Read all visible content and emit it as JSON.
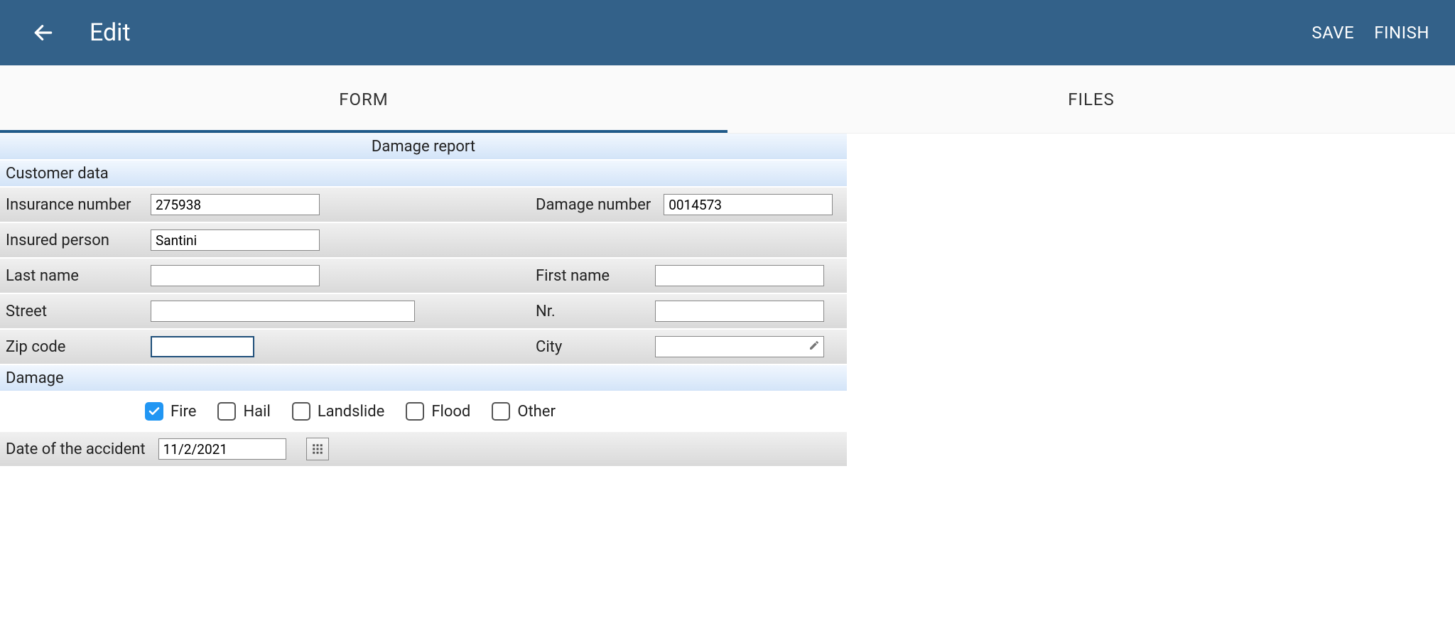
{
  "appbar": {
    "title": "Edit",
    "save_label": "SAVE",
    "finish_label": "FINISH"
  },
  "tabs": {
    "form": "FORM",
    "files": "FILES"
  },
  "form": {
    "report_title": "Damage report",
    "customer_section": "Customer data",
    "damage_section": "Damage",
    "labels": {
      "insurance_number": "Insurance number",
      "damage_number": "Damage number",
      "insured_person": "Insured person",
      "last_name": "Last name",
      "first_name": "First name",
      "street": "Street",
      "nr": "Nr.",
      "zip": "Zip code",
      "city": "City",
      "accident_date": "Date of the accident"
    },
    "values": {
      "insurance_number": "275938",
      "damage_number": "0014573",
      "insured_person": "Santini",
      "last_name": "",
      "first_name": "",
      "street": "",
      "nr": "",
      "zip": "",
      "city": "",
      "accident_date": "11/2/2021"
    },
    "damage_types": {
      "fire": {
        "label": "Fire",
        "checked": true
      },
      "hail": {
        "label": "Hail",
        "checked": false
      },
      "landslide": {
        "label": "Landslide",
        "checked": false
      },
      "flood": {
        "label": "Flood",
        "checked": false
      },
      "other": {
        "label": "Other",
        "checked": false
      }
    }
  }
}
